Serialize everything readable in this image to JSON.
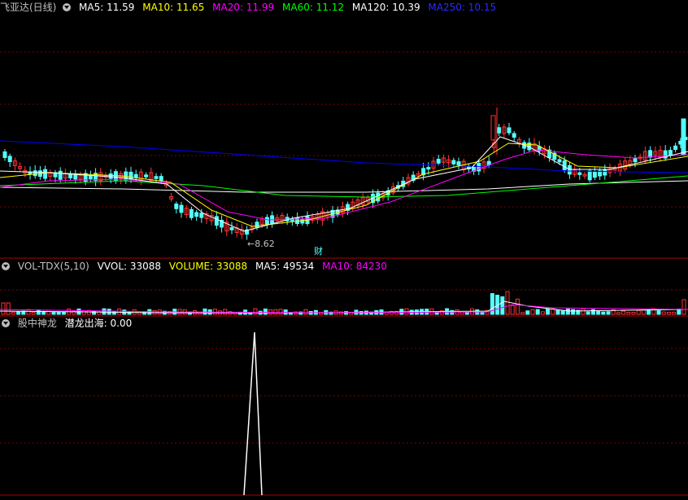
{
  "main_legend": {
    "title": "飞亚达(日线)",
    "items": [
      {
        "label": "MA5: 11.59",
        "color": "#ffffff"
      },
      {
        "label": "MA10: 11.65",
        "color": "#ffff00"
      },
      {
        "label": "MA20: 11.99",
        "color": "#ff00ff"
      },
      {
        "label": "MA60: 11.12",
        "color": "#00ff00"
      },
      {
        "label": "MA120: 10.39",
        "color": "#ffffff"
      },
      {
        "label": "MA250: 10.15",
        "color": "#0000ff"
      }
    ]
  },
  "low_price_label": "8.62",
  "finance_marker": "财",
  "vol_legend": {
    "title": "VOL-TDX(5,10)",
    "items": [
      {
        "label": "VVOL: 33088",
        "color": "#ffffff"
      },
      {
        "label": "VOLUME: 33088",
        "color": "#ffff00"
      },
      {
        "label": "MA5: 49534",
        "color": "#ffffff"
      },
      {
        "label": "MA10: 84230",
        "color": "#ff00ff"
      }
    ]
  },
  "indicator_legend": {
    "title": "股中神龙",
    "items": [
      {
        "label": "潜龙出海: 0.00",
        "color": "#ffffff"
      }
    ]
  },
  "colors": {
    "up": "#ff3232",
    "down": "#54ffff",
    "grid": "#7a0000",
    "divider": "#b00000"
  }
}
